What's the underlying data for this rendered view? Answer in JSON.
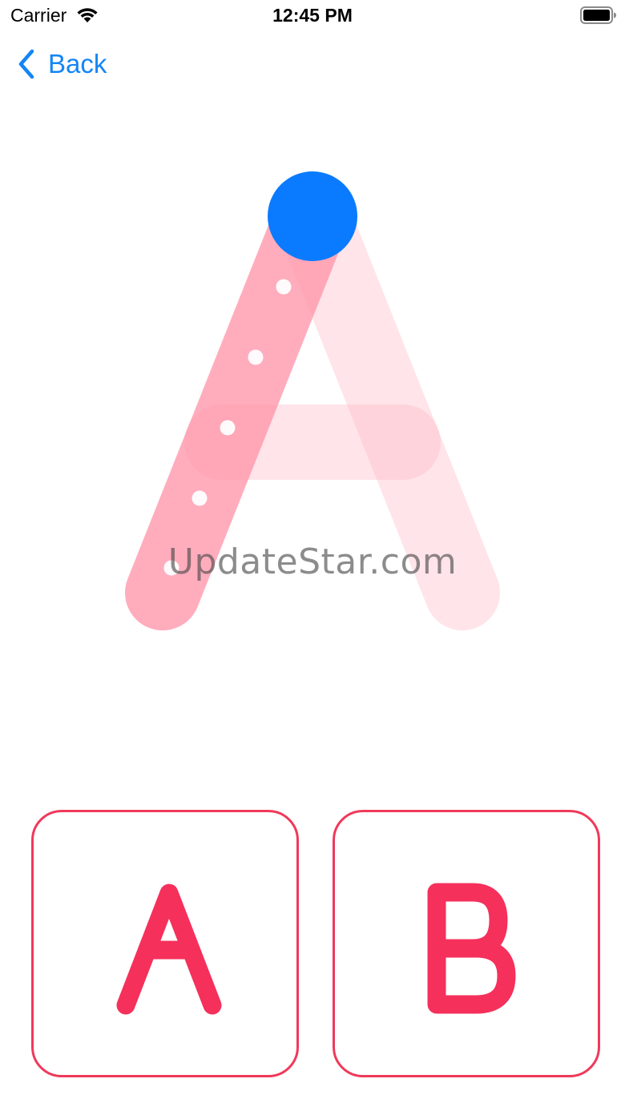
{
  "status_bar": {
    "carrier": "Carrier",
    "time": "12:45 PM",
    "wifi_icon": "wifi-icon",
    "battery_icon": "battery-full-icon"
  },
  "nav": {
    "back_label": "Back",
    "back_icon": "chevron-left-icon"
  },
  "tracing": {
    "letter": "A",
    "stroke_count": 3,
    "active_stroke": 1,
    "guide_dots_on_active_stroke": 5,
    "watermark": "UpdateStar.com"
  },
  "choices": [
    {
      "letter": "A"
    },
    {
      "letter": "B"
    }
  ],
  "colors": {
    "accent_blue": "#1485f5",
    "touch_point_blue": "#0a7bff",
    "stroke_active": "#ffa5b6",
    "stroke_inactive": "#ffe6eb",
    "card_border": "#f0395a",
    "card_letter": "#f5305b"
  }
}
